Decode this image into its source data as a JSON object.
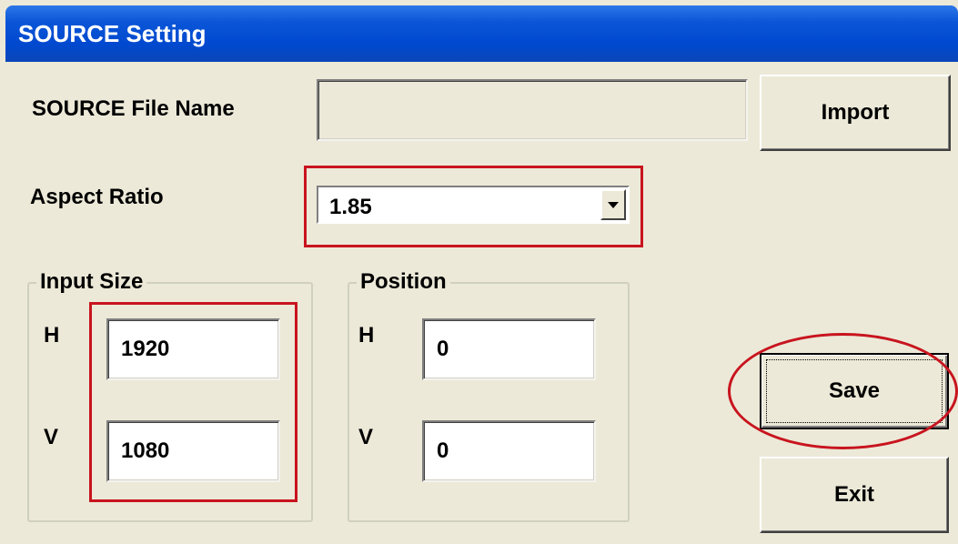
{
  "window": {
    "title": "SOURCE Setting"
  },
  "source_file": {
    "label": "SOURCE File Name",
    "value": ""
  },
  "import_button": {
    "label": "Import"
  },
  "aspect_ratio": {
    "label": "Aspect Ratio",
    "selected": "1.85"
  },
  "input_size": {
    "legend": "Input Size",
    "h_label": "H",
    "h_value": "1920",
    "v_label": "V",
    "v_value": "1080"
  },
  "position": {
    "legend": "Position",
    "h_label": "H",
    "h_value": "0",
    "v_label": "V",
    "v_value": "0"
  },
  "save_button": {
    "label": "Save"
  },
  "exit_button": {
    "label": "Exit"
  },
  "colors": {
    "titlebar": "#0a55d7",
    "dialog_bg": "#ece9d8",
    "annotation": "#c8141e"
  }
}
